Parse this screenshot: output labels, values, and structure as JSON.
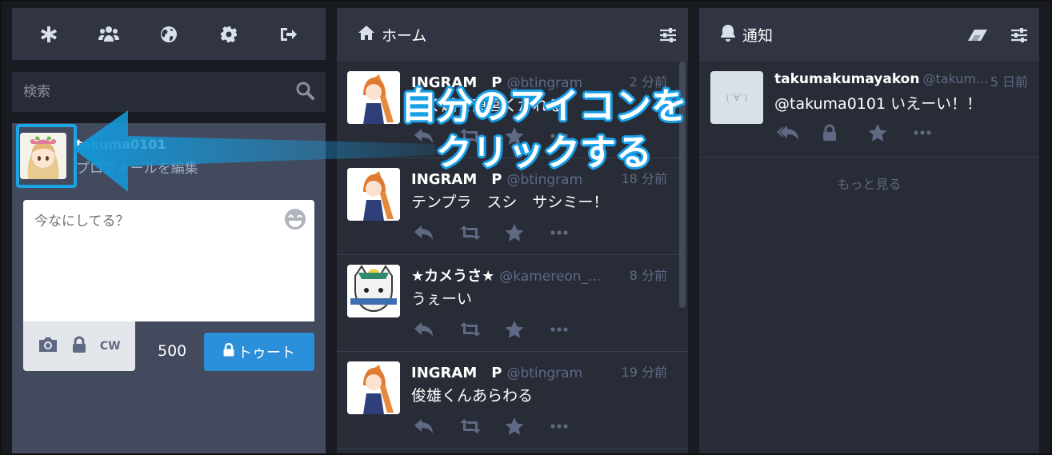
{
  "drawer": {
    "nav": [
      "asterisk-icon",
      "users-icon",
      "globe-icon",
      "gear-icon",
      "sign-out-icon"
    ],
    "search_placeholder": "検索",
    "account": {
      "handle": "takuma0101",
      "edit_profile": "プロフィールを編集"
    },
    "compose": {
      "placeholder": "今なにしてる？",
      "cw_label": "CW",
      "char_count": "500",
      "toot_label": "トゥート"
    }
  },
  "home": {
    "title": "ホーム",
    "statuses": [
      {
        "name": "INGRAM　P",
        "handle": "@btingram",
        "time": "2 分前",
        "body": "ぐく越を東宮くかれる"
      },
      {
        "name": "INGRAM　P",
        "handle": "@btingram",
        "time": "18 分前",
        "body": "テンプラ　スシ　サシミー！"
      },
      {
        "name": "★カメうさ★",
        "handle": "@kamereon_...",
        "time": "8 分前",
        "body": "うぇーい"
      },
      {
        "name": "INGRAM　P",
        "handle": "@btingram",
        "time": "19 分前",
        "body": "俊雄くんあらわる"
      }
    ]
  },
  "notifications": {
    "title": "通知",
    "items": [
      {
        "name": "takumakumayakon",
        "handle": "@takum...",
        "time": "5 日前",
        "body": "@takuma0101 いえーい！！",
        "avatar_text": "(´∀`)"
      }
    ],
    "load_more": "もっと見る"
  },
  "annotation": {
    "line1": "自分のアイコンを",
    "line2": "クリックする",
    "color": "#1aa0e8"
  }
}
